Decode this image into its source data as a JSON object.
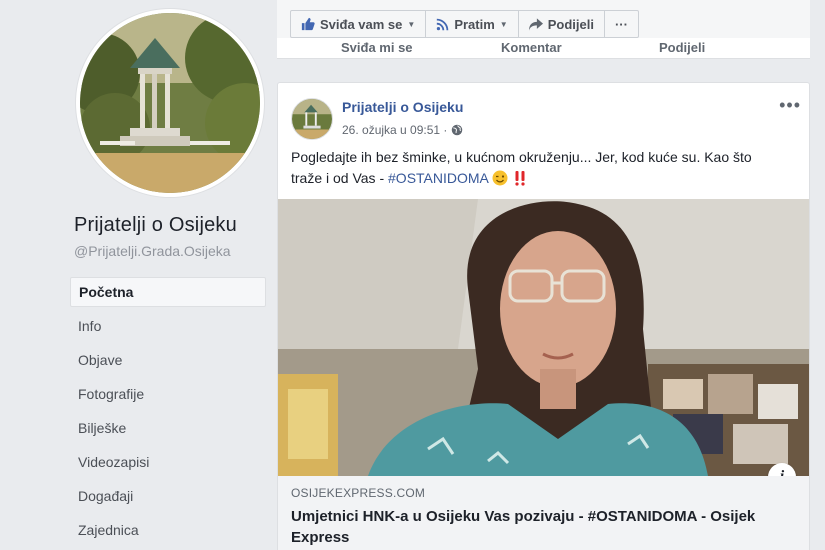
{
  "sidebar": {
    "page_name": "Prijatelji o Osijeku",
    "page_handle": "@Prijatelji.Grada.Osijeka",
    "nav": [
      {
        "label": "Početna",
        "active": true
      },
      {
        "label": "Info"
      },
      {
        "label": "Objave"
      },
      {
        "label": "Fotografije"
      },
      {
        "label": "Bilješke"
      },
      {
        "label": "Videozapisi"
      },
      {
        "label": "Događaji"
      },
      {
        "label": "Zajednica"
      }
    ]
  },
  "topbar": {
    "like_label": "Sviđa vam se",
    "follow_label": "Pratim",
    "share_label": "Podijeli",
    "more_label": "···",
    "cut_like": "Sviđa mi se",
    "cut_comment": "Komentar",
    "cut_share": "Podijeli"
  },
  "post": {
    "author": "Prijatelji o Osijeku",
    "timestamp": "26. ožujka u 09:51 ·",
    "more_label": "•••",
    "text_line1": "Pogledajte ih bez šminke, u kućnom okruženju... Jer, kod kuće su. Kao što",
    "text_line2": "traže i od Vas - ",
    "hashtag": "#OSTANIDOMA",
    "link_domain": "OSIJEKEXPRESS.COM",
    "link_title": "Umjetnici HNK-a u Osijeku Vas pozivaju - #OSTANIDOMA - Osijek Express",
    "info_label": "i"
  },
  "colors": {
    "link_blue": "#385898",
    "background": "#e9ebee",
    "button_bg": "#f5f6f7"
  },
  "icons": [
    "thumbs-up-icon",
    "rss-icon",
    "share-arrow-icon",
    "globe-icon",
    "info-icon",
    "wink-emoji-icon",
    "double-exclamation-icon"
  ]
}
